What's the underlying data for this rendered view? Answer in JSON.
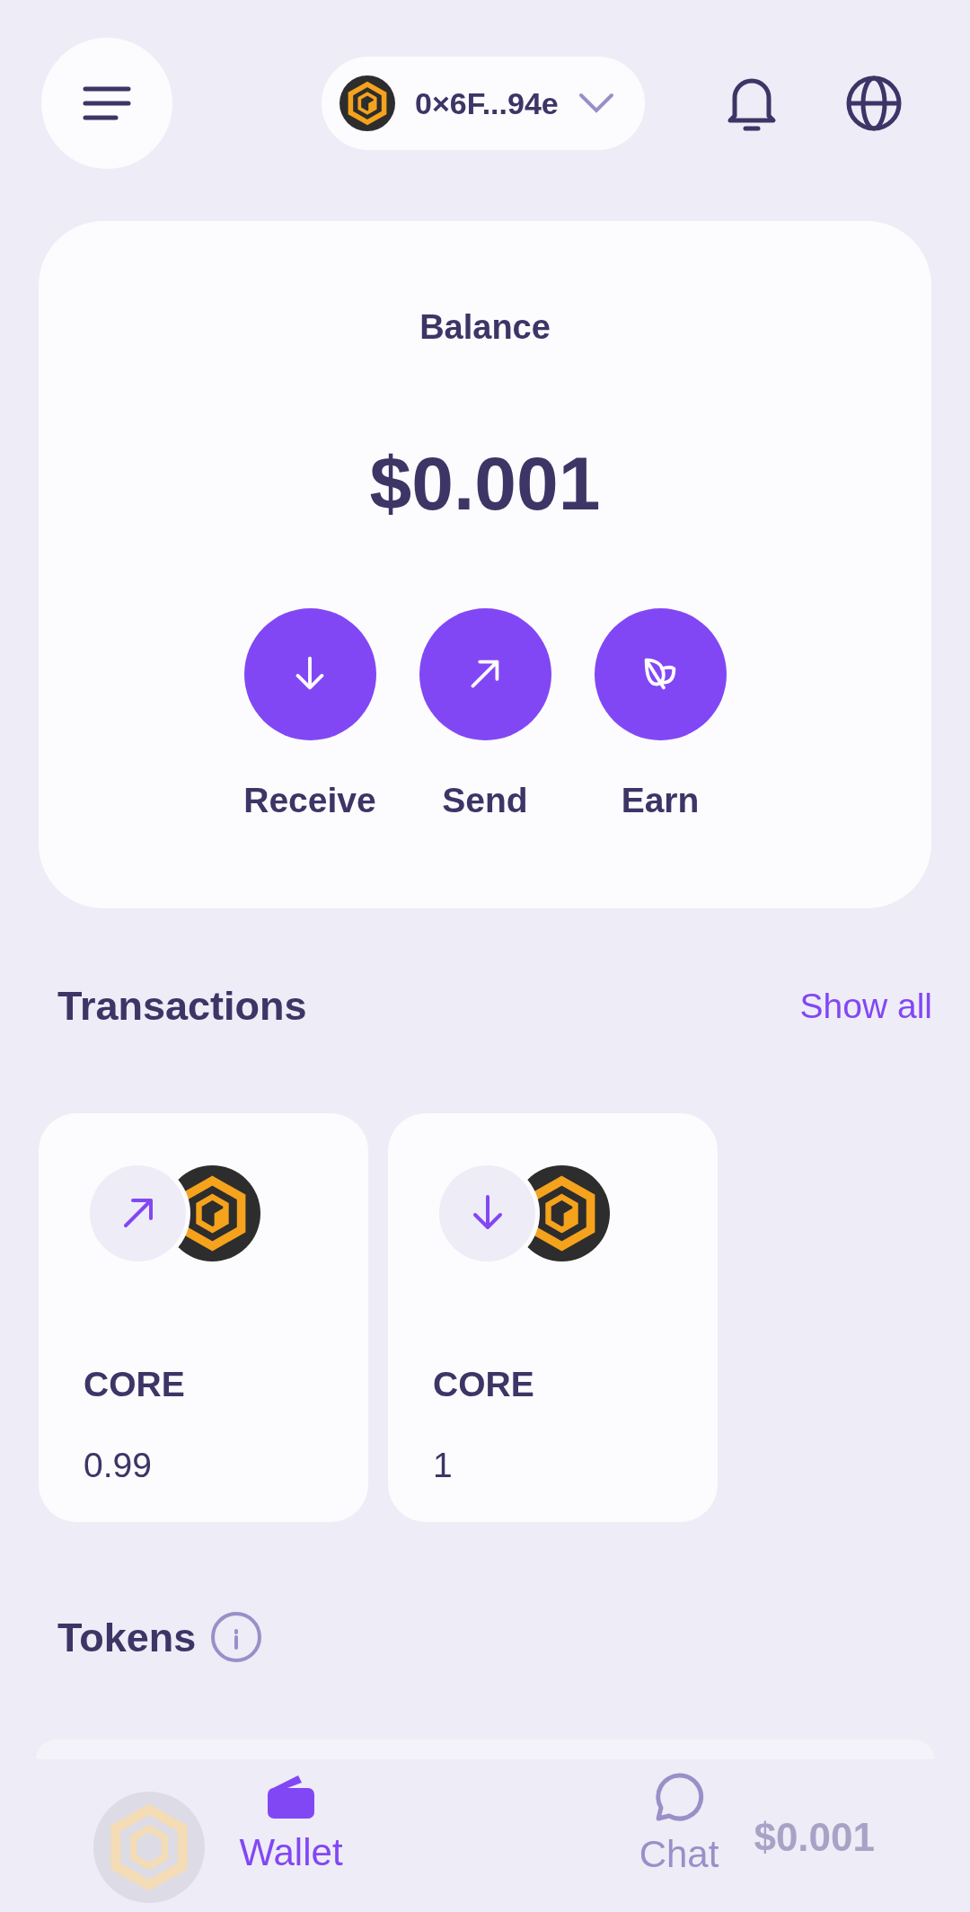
{
  "header": {
    "account": {
      "address": "0×6F...94e"
    }
  },
  "balance": {
    "label": "Balance",
    "amount": "$0.001"
  },
  "actions": [
    {
      "kind": "receive",
      "label": "Receive"
    },
    {
      "kind": "send",
      "label": "Send"
    },
    {
      "kind": "earn",
      "label": "Earn"
    }
  ],
  "transactions": {
    "title": "Transactions",
    "show_all": "Show all",
    "items": [
      {
        "kind": "send",
        "token": "CORE",
        "amount": "0.99"
      },
      {
        "kind": "receive",
        "token": "CORE",
        "amount": "1"
      }
    ]
  },
  "tokens": {
    "title": "Tokens",
    "items": [
      {
        "value": "$0.001"
      }
    ]
  },
  "bottom_nav": [
    {
      "kind": "wallet",
      "label": "Wallet",
      "selected": true
    },
    {
      "kind": "chat",
      "label": "Chat",
      "selected": false
    }
  ]
}
